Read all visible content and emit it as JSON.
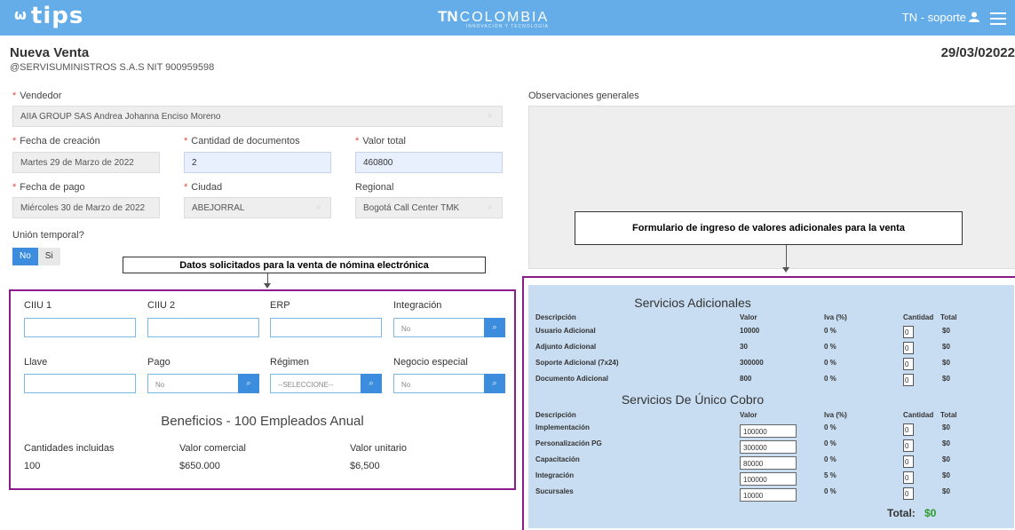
{
  "header": {
    "logo": "tips",
    "brand_tn": "TN",
    "brand_name": "COLOMBIA",
    "brand_tagline": "INNOVACIÓN Y TECNOLOGÍA",
    "user": "TN - soporte"
  },
  "page": {
    "title": "Nueva Venta",
    "company": "@SERVISUMINISTROS S.A.S NIT 900959598",
    "date": "29/03/02022"
  },
  "form": {
    "vendedor_label": "Vendedor",
    "vendedor_value": "AIIA GROUP SAS Andrea Johanna Enciso Moreno",
    "fecha_creacion_label": "Fecha de creación",
    "fecha_creacion_value": "Martes 29 de Marzo de 2022",
    "cantidad_label": "Cantidad de documentos",
    "cantidad_value": "2",
    "valor_total_label": "Valor total",
    "valor_total_value": "460800",
    "fecha_pago_label": "Fecha de pago",
    "fecha_pago_value": "Miércoles 30 de Marzo de 2022",
    "ciudad_label": "Ciudad",
    "ciudad_value": "ABEJORRAL",
    "regional_label": "Regional",
    "regional_value": "Bogotá Call Center TMK",
    "union_label": "Unión temporal?",
    "union_no": "No",
    "union_si": "Si",
    "obs_label": "Observaciones generales"
  },
  "callouts": {
    "left": "Datos solicitados para la venta de nómina electrónica",
    "right": "Formulario de ingreso de valores adicionales para la venta"
  },
  "nomina": {
    "ciiu1": "CIIU 1",
    "ciiu2": "CIIU 2",
    "erp": "ERP",
    "integracion_label": "Integración",
    "integracion_value": "No",
    "llave": "Llave",
    "pago_label": "Pago",
    "pago_value": "No",
    "regimen_label": "Régimen",
    "regimen_value": "--SELECCIONE--",
    "negocio_label": "Negocio especial",
    "negocio_value": "No",
    "beneficios_title": "Beneficios - 100 Empleados Anual",
    "col_cantidades": "Cantidades incluidas",
    "col_valor_comercial": "Valor comercial",
    "col_valor_unitario": "Valor unitario",
    "val_cantidades": "100",
    "val_valor_comercial": "$650.000",
    "val_valor_unitario": "$6,500"
  },
  "servicios": {
    "adicionales_title": "Servicios Adicionales",
    "unico_title": "Servicios De Único Cobro",
    "h_desc": "Descripción",
    "h_valor": "Valor",
    "h_iva": "Iva (%)",
    "h_cantidad": "Cantidad",
    "h_total": "Total",
    "adicionales": [
      {
        "desc": "Usuario Adicional",
        "valor": "10000",
        "iva": "0 %",
        "qty": "0",
        "total": "$0"
      },
      {
        "desc": "Adjunto Adicional",
        "valor": "30",
        "iva": "0 %",
        "qty": "0",
        "total": "$0"
      },
      {
        "desc": "Soporte Adicional (7x24)",
        "valor": "300000",
        "iva": "0 %",
        "qty": "0",
        "total": "$0"
      },
      {
        "desc": "Documento Adicional",
        "valor": "800",
        "iva": "0 %",
        "qty": "0",
        "total": "$0"
      }
    ],
    "unico": [
      {
        "desc": "Implementación",
        "valor": "100000",
        "iva": "0 %",
        "qty": "0",
        "total": "$0"
      },
      {
        "desc": "Personalización PG",
        "valor": "300000",
        "iva": "0 %",
        "qty": "0",
        "total": "$0"
      },
      {
        "desc": "Capacitación",
        "valor": "80000",
        "iva": "0 %",
        "qty": "0",
        "total": "$0"
      },
      {
        "desc": "Integración",
        "valor": "100000",
        "iva": "5 %",
        "qty": "0",
        "total": "$0"
      },
      {
        "desc": "Sucursales",
        "valor": "10000",
        "iva": "0 %",
        "qty": "0",
        "total": "$0"
      }
    ],
    "total_label": "Total:",
    "total_value": "$0"
  },
  "colors": {
    "topbar": "#64ade9",
    "accent": "#3c8dde",
    "panel_border": "#8b1a8b",
    "services_bg": "#c8ddf1",
    "total_green": "#2c9a2c",
    "required": "#e2483d"
  },
  "icons": [
    "tips-logo-glyph",
    "user-icon",
    "menu-icon",
    "search-icon"
  ]
}
